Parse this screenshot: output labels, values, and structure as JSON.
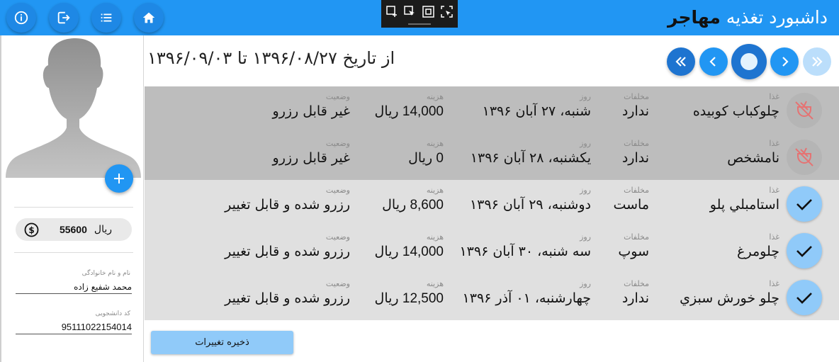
{
  "header": {
    "title_prefix": "داشبورد تغذیه",
    "title_name": "مهاجر",
    "buttons": [
      {
        "icon": "info-icon"
      },
      {
        "icon": "exit-icon"
      },
      {
        "icon": "list-icon"
      },
      {
        "icon": "home-icon"
      }
    ],
    "tools": [
      "screenshot-add-icon",
      "select-region-icon",
      "fullscreen-icon",
      "capture-icon"
    ]
  },
  "sidebar": {
    "balance_amount": "55600",
    "balance_currency": "ریال",
    "name_label": "نام و نام خانوادگی",
    "name_value": "محمد شفیع زاده",
    "student_id_label": "کد دانشجویی",
    "student_id_value": "95111022154014"
  },
  "main": {
    "date_range": "از تاریخ ۱۳۹۶/۰۸/۲۷ تا ۱۳۹۶/۰۹/۰۳",
    "save_label": "ذخیره تغییرات",
    "column_labels": {
      "food": "غذا",
      "sides": "مخلفات",
      "day": "روز",
      "cost": "هزینه",
      "status": "وضعیت"
    },
    "rows": [
      {
        "food": "چلوکباب کوبیده",
        "sides": "ندارد",
        "day": "شنبه، ۲۷ آبان ۱۳۹۶",
        "cost": "14,000 ریال",
        "status": "غیر قابل رزرو",
        "state": "locked"
      },
      {
        "food": "نامشخص",
        "sides": "ندارد",
        "day": "یکشنبه، ۲۸ آبان ۱۳۹۶",
        "cost": "0 ریال",
        "status": "غیر قابل رزرو",
        "state": "locked"
      },
      {
        "food": "استامبلي پلو",
        "sides": "ماست",
        "day": "دوشنبه، ۲۹ آبان ۱۳۹۶",
        "cost": "8,600 ریال",
        "status": "رزرو شده و قابل تغییر",
        "state": "reserved"
      },
      {
        "food": "چلومرغ",
        "sides": "سوپ",
        "day": "سه شنبه، ۳۰ آبان ۱۳۹۶",
        "cost": "14,000 ریال",
        "status": "رزرو شده و قابل تغییر",
        "state": "reserved"
      },
      {
        "food": "چلو خورش سبزي",
        "sides": "ندارد",
        "day": "چهارشنبه، ۰۱ آذر ۱۳۹۶",
        "cost": "12,500 ریال",
        "status": "رزرو شده و قابل تغییر",
        "state": "reserved"
      }
    ]
  },
  "colors": {
    "topbar": "#2196f3",
    "locked_row": "#bdbdbd",
    "open_row": "#e0e0e0",
    "check_circle": "#90caf9",
    "save_button": "#90caf9"
  }
}
